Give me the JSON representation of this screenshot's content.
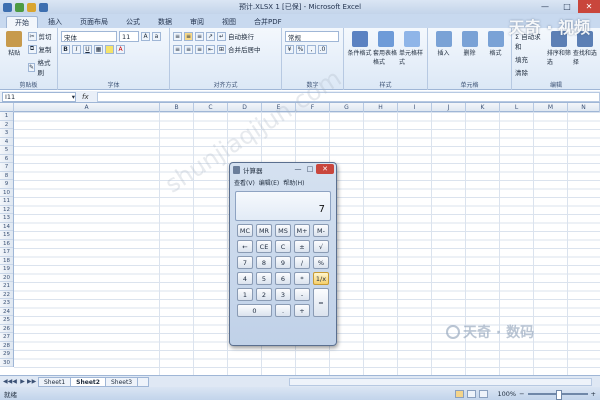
{
  "window": {
    "title": "预计.XLSX 1 [已保] - Microsoft Excel",
    "controls": [
      "—",
      "□",
      "✕"
    ]
  },
  "ribbon": {
    "tabs": [
      "开始",
      "插入",
      "页面布局",
      "公式",
      "数据",
      "审阅",
      "视图",
      "合并PDF"
    ],
    "groups": {
      "clipboard": {
        "label": "剪贴板",
        "paste": "粘贴",
        "cut": "剪切",
        "copy": "复制",
        "format_painter": "格式刷"
      },
      "font": {
        "label": "字体",
        "font_name": "宋体",
        "font_size": "11",
        "bold": "B",
        "italic": "I",
        "underline": "U"
      },
      "alignment": {
        "label": "对齐方式",
        "wrap": "自动换行",
        "merge": "合并后居中"
      },
      "number": {
        "label": "数字",
        "format": "常规",
        "percent": "%"
      },
      "styles": {
        "label": "样式",
        "conditional": "条件格式",
        "table": "套用表格格式",
        "cell": "单元格样式"
      },
      "cells": {
        "label": "单元格",
        "insert": "插入",
        "delete": "删除",
        "format": "格式"
      },
      "editing": {
        "label": "编辑",
        "sum": "Σ 自动求和",
        "fill": "填充",
        "clear": "清除",
        "sort": "排序和筛选",
        "find": "查找和选择"
      }
    }
  },
  "formula_bar": {
    "name_box": "I11",
    "fx": "fx",
    "content": ""
  },
  "grid": {
    "columns": [
      "A",
      "B",
      "C",
      "D",
      "E",
      "F",
      "G",
      "H",
      "I",
      "J",
      "K",
      "L",
      "M",
      "N"
    ],
    "rows": [
      "1",
      "2",
      "3",
      "4",
      "5",
      "6",
      "7",
      "8",
      "9",
      "10",
      "11",
      "12",
      "13",
      "14",
      "15",
      "16",
      "17",
      "18",
      "19",
      "20",
      "21",
      "22",
      "23",
      "24",
      "25",
      "26",
      "27",
      "28",
      "29",
      "30"
    ]
  },
  "sheets": {
    "nav": [
      "◀◀",
      "◀",
      "▶",
      "▶▶"
    ],
    "tabs": [
      "Sheet1",
      "Sheet2",
      "Sheet3"
    ],
    "active": "Sheet2"
  },
  "status": {
    "ready": "就绪",
    "zoom": "100%",
    "zoom_out": "−",
    "zoom_in": "+"
  },
  "calculator": {
    "title": "计算器",
    "menu": [
      "查看(V)",
      "编辑(E)",
      "帮助(H)"
    ],
    "display": "7",
    "keys": [
      [
        "MC",
        "MR",
        "MS",
        "M+",
        "M-"
      ],
      [
        "←",
        "CE",
        "C",
        "±",
        "√"
      ],
      [
        "7",
        "8",
        "9",
        "/",
        "%"
      ],
      [
        "4",
        "5",
        "6",
        "*",
        "1/x"
      ],
      [
        "1",
        "2",
        "3",
        "-",
        "="
      ],
      [
        "0",
        ".",
        "+"
      ]
    ]
  },
  "watermarks": {
    "top": "天奇 · 视频",
    "url": "shunjiaqijun.com",
    "bottom": "天奇 · 数码"
  }
}
